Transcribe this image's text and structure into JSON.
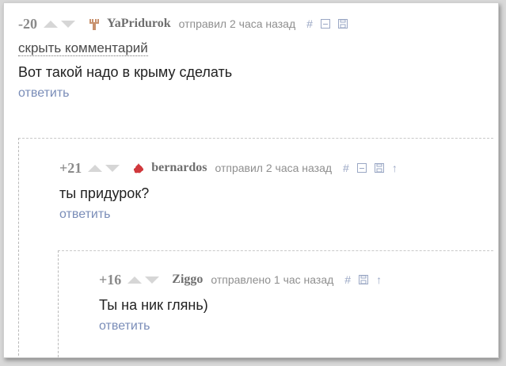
{
  "comments": [
    {
      "rating": "-20",
      "author": "YaPridurok",
      "meta": "отправил 2 часа назад",
      "hide_label": "скрыть комментарий",
      "text": "Вот такой надо в крыму сделать",
      "reply_label": "ответить",
      "avatar_icon": "pitchfork-avatar-icon",
      "avatar_color": "#c8926e"
    },
    {
      "rating": "+21",
      "author": "bernardos",
      "meta": "отправил 2 часа назад",
      "text": "ты придурок?",
      "reply_label": "ответить",
      "avatar_icon": "blood-splat-avatar-icon",
      "avatar_color": "#d0383c"
    },
    {
      "rating": "+16",
      "author": "Ziggo",
      "meta": "отправлено 1 час назад",
      "text": "Ты на ник глянь)",
      "reply_label": "ответить"
    }
  ],
  "icons": {
    "hash": "#",
    "parent_arrow": "↑"
  },
  "colors": {
    "rating": "#8a8a8a",
    "link": "#7a8db8",
    "tool": "#9aa7c4",
    "text": "#222222"
  }
}
